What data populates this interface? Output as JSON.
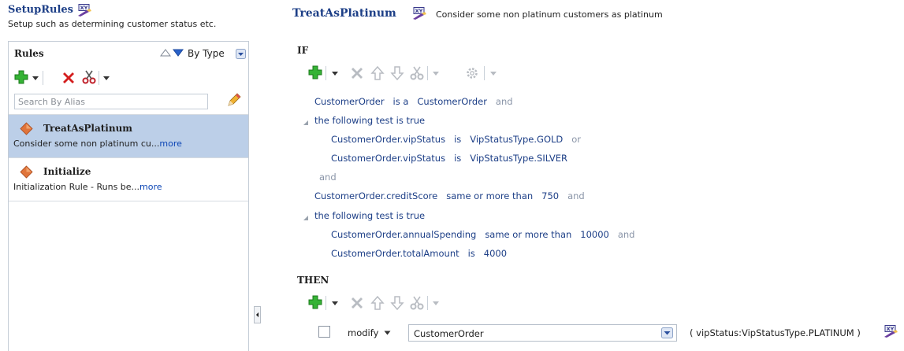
{
  "ruleset": {
    "title": "SetupRules",
    "description": "Setup such as determining customer status etc."
  },
  "rules_panel": {
    "label": "Rules",
    "sort_label": "By Type",
    "search_placeholder": "Search By Alias",
    "items": [
      {
        "name": "TreatAsPlatinum",
        "desc": "Consider some non platinum cu...",
        "more": "more",
        "selected": true
      },
      {
        "name": "Initialize",
        "desc": "Initialization Rule - Runs be...",
        "more": "more",
        "selected": false
      }
    ]
  },
  "rule": {
    "title": "TreatAsPlatinum",
    "description": "Consider some non platinum customers as platinum",
    "if_label": "IF",
    "then_label": "THEN",
    "conditions": [
      {
        "parts": [
          "CustomerOrder",
          "is a",
          "CustomerOrder"
        ],
        "connector": "and"
      },
      {
        "parts": [
          "the following test is true"
        ],
        "connector": ""
      },
      {
        "parts": [
          "CustomerOrder.vipStatus",
          "is",
          "VipStatusType.GOLD"
        ],
        "connector": "or"
      },
      {
        "parts": [
          "CustomerOrder.vipStatus",
          "is",
          "VipStatusType.SILVER"
        ],
        "connector": ""
      },
      {
        "parts": [],
        "connector": "and"
      },
      {
        "parts": [
          "CustomerOrder.creditScore",
          "same or more than",
          "750"
        ],
        "connector": "and"
      },
      {
        "parts": [
          "the following test is true"
        ],
        "connector": ""
      },
      {
        "parts": [
          "CustomerOrder.annualSpending",
          "same or more than",
          "10000"
        ],
        "connector": "and"
      },
      {
        "parts": [
          "CustomerOrder.totalAmount",
          "is",
          "4000"
        ],
        "connector": ""
      }
    ],
    "action": {
      "verb": "modify",
      "target": "CustomerOrder",
      "args": "( vipStatus:VipStatusType.PLATINUM )"
    }
  },
  "colors": {
    "title_blue": "#1d3f87",
    "link_blue": "#0b45b5",
    "connector_gray": "#8a95a8",
    "selected_row": "#bccfe8",
    "diamond_orange": "#e0743a",
    "add_green": "#2da52d",
    "delete_red": "#d41e1e"
  },
  "icons": {
    "ruleset": "xy-edit-icon",
    "add": "add-plus-icon",
    "delete": "delete-x-icon",
    "cut": "scissors-icon",
    "up": "move-up-icon",
    "down": "move-down-icon",
    "settings": "gear-icon",
    "pencil": "pencil-icon",
    "rule": "rule-diamond-icon"
  }
}
